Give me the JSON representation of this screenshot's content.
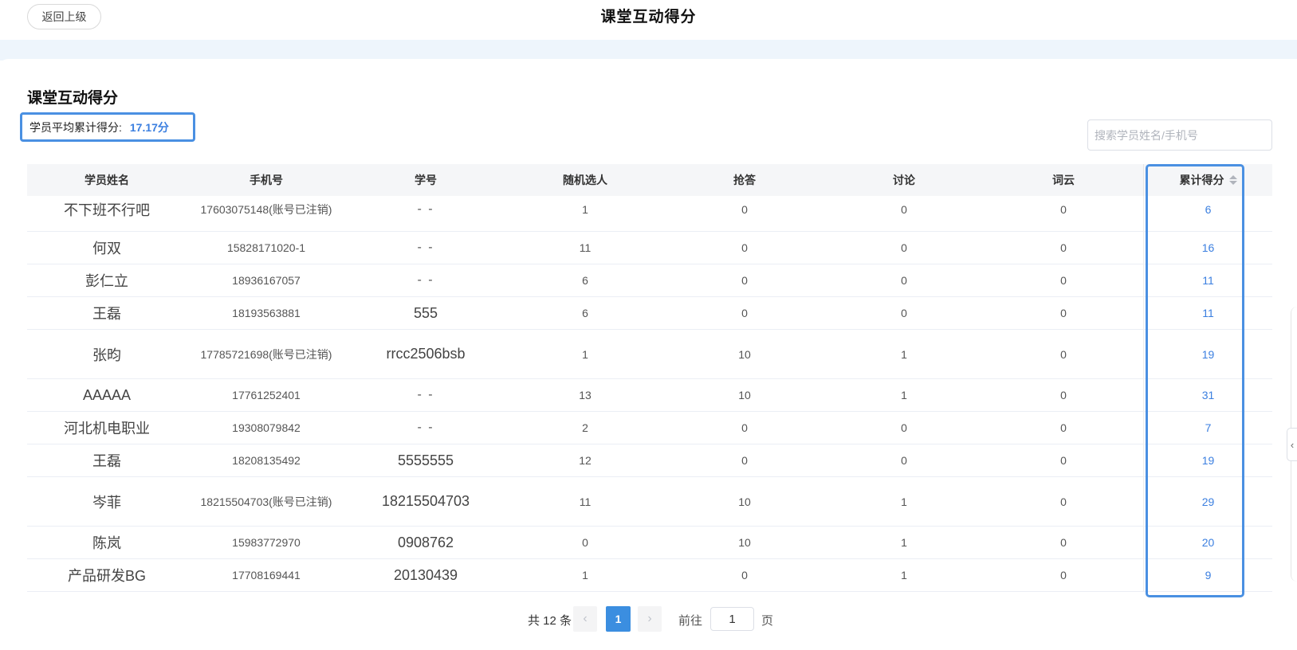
{
  "header": {
    "back_label": "返回上级",
    "title": "课堂互动得分"
  },
  "section": {
    "title": "课堂互动得分",
    "avg_label": "学员平均累计得分:",
    "avg_value": "17.17分"
  },
  "search": {
    "placeholder": "搜索学员姓名/手机号"
  },
  "table": {
    "columns": [
      "学员姓名",
      "手机号",
      "学号",
      "随机选人",
      "抢答",
      "讨论",
      "词云",
      "累计得分"
    ],
    "rows": [
      {
        "name": "不下班不行吧",
        "phone": "17603075148(账号已注销)",
        "sid": "- -",
        "random": "1",
        "quick": "0",
        "discuss": "0",
        "cloud": "0",
        "total": "6"
      },
      {
        "name": "何双",
        "phone": "15828171020-1",
        "sid": "- -",
        "random": "11",
        "quick": "0",
        "discuss": "0",
        "cloud": "0",
        "total": "16"
      },
      {
        "name": "彭仁立",
        "phone": "18936167057",
        "sid": "- -",
        "random": "6",
        "quick": "0",
        "discuss": "0",
        "cloud": "0",
        "total": "11"
      },
      {
        "name": "王磊",
        "phone": "18193563881",
        "sid": "555",
        "random": "6",
        "quick": "0",
        "discuss": "0",
        "cloud": "0",
        "total": "11"
      },
      {
        "name": "张昀",
        "phone": "17785721698(账号已注销)",
        "sid": "rrcc2506bsb",
        "random": "1",
        "quick": "10",
        "discuss": "1",
        "cloud": "0",
        "total": "19"
      },
      {
        "name": "AAAAA",
        "phone": "17761252401",
        "sid": "- -",
        "random": "13",
        "quick": "10",
        "discuss": "1",
        "cloud": "0",
        "total": "31"
      },
      {
        "name": "河北机电职业",
        "phone": "19308079842",
        "sid": "- -",
        "random": "2",
        "quick": "0",
        "discuss": "0",
        "cloud": "0",
        "total": "7"
      },
      {
        "name": "王磊",
        "phone": "18208135492",
        "sid": "5555555",
        "random": "12",
        "quick": "0",
        "discuss": "0",
        "cloud": "0",
        "total": "19"
      },
      {
        "name": "岑菲",
        "phone": "18215504703(账号已注销)",
        "sid": "18215504703",
        "random": "11",
        "quick": "10",
        "discuss": "1",
        "cloud": "0",
        "total": "29"
      },
      {
        "name": "陈岚",
        "phone": "15983772970",
        "sid": "0908762",
        "random": "0",
        "quick": "10",
        "discuss": "1",
        "cloud": "0",
        "total": "20"
      },
      {
        "name": "产品研发BG",
        "phone": "17708169441",
        "sid": "20130439",
        "random": "1",
        "quick": "0",
        "discuss": "1",
        "cloud": "0",
        "total": "9"
      }
    ]
  },
  "pager": {
    "total_text": "共 12 条",
    "prev": "‹",
    "current": "1",
    "next": "›",
    "goto_label": "前往",
    "goto_value": "1",
    "unit": "页"
  },
  "side_toggle": "‹"
}
